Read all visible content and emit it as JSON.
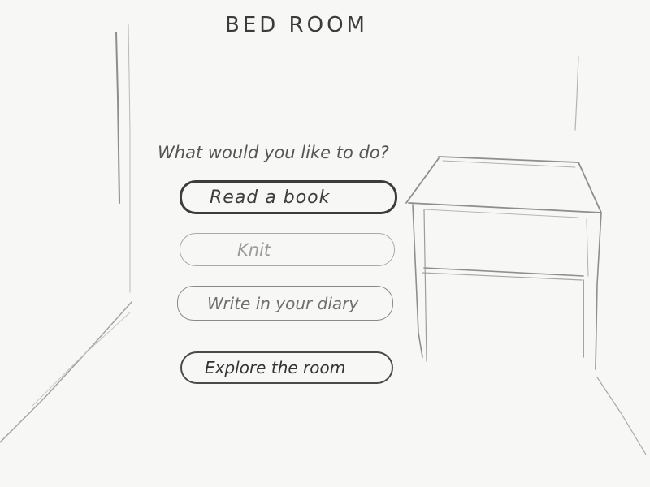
{
  "room": {
    "title": "BED ROOM"
  },
  "menu": {
    "prompt": "What would you like to do?",
    "options": [
      {
        "label": "Read a book"
      },
      {
        "label": "Knit"
      },
      {
        "label": "Write in your diary"
      },
      {
        "label": "Explore the room"
      }
    ]
  }
}
